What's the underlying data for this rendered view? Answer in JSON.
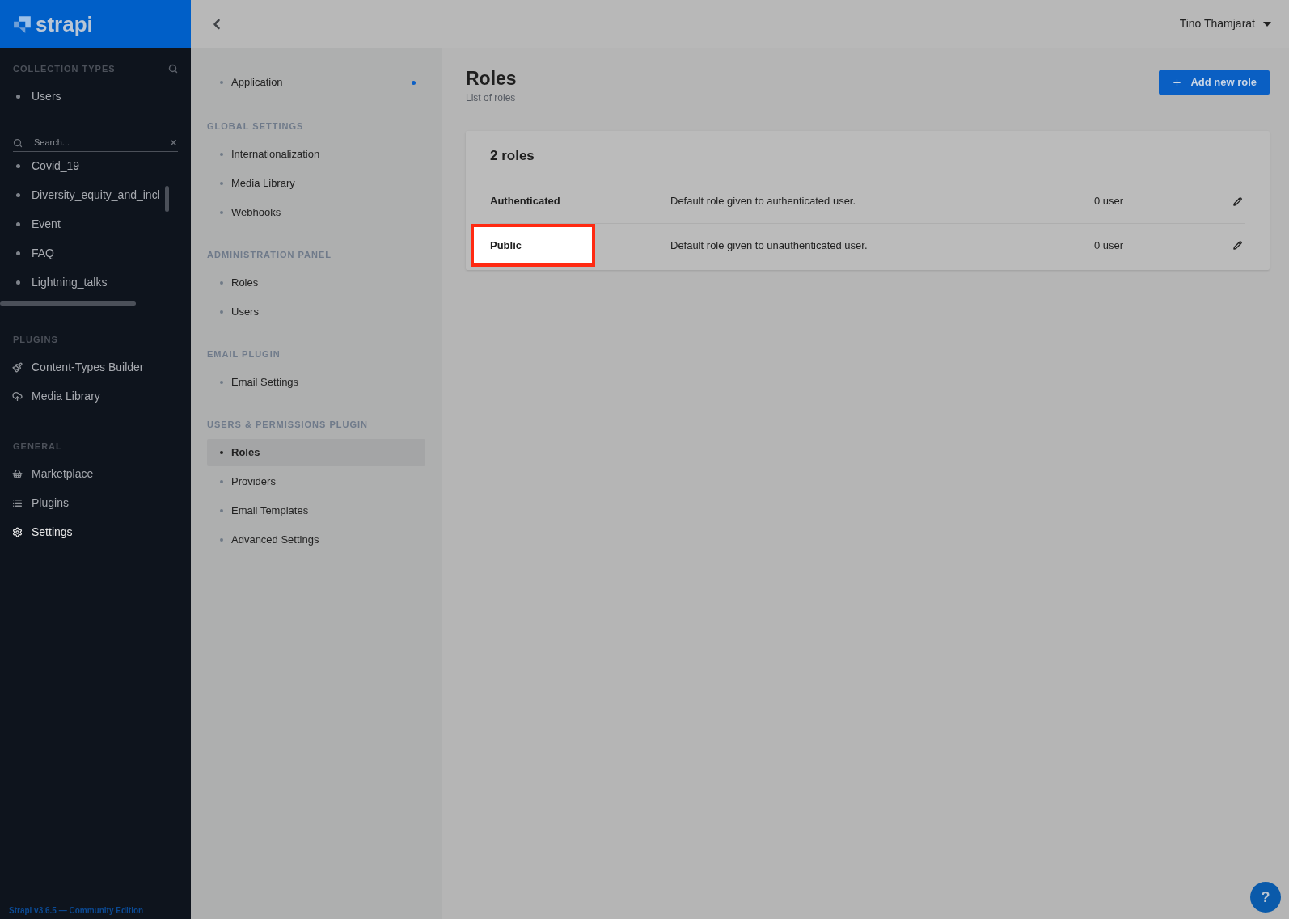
{
  "sidebar": {
    "logo": "strapi",
    "sections": [
      {
        "title": "COLLECTION TYPES",
        "has_search": true,
        "items": [
          {
            "label": "Users",
            "kind": "bullet",
            "selected": false
          }
        ]
      }
    ],
    "search": {
      "placeholder": "Search..."
    },
    "search_results": [
      {
        "label": "Covid_19"
      },
      {
        "label": "Diversity_equity_and_incl"
      },
      {
        "label": "Event"
      },
      {
        "label": "FAQ"
      },
      {
        "label": "Lightning_talks"
      }
    ],
    "groups": [
      {
        "title": "PLUGINS",
        "items": [
          {
            "label": "Content-Types Builder",
            "kind": "brush",
            "selected": false
          },
          {
            "label": "Media Library",
            "kind": "cloud",
            "selected": false
          }
        ]
      },
      {
        "title": "GENERAL",
        "items": [
          {
            "label": "Marketplace",
            "kind": "basket",
            "selected": false
          },
          {
            "label": "Plugins",
            "kind": "list",
            "selected": false
          },
          {
            "label": "Settings",
            "kind": "gear",
            "selected": true
          }
        ]
      }
    ],
    "footer": "Strapi v3.6.5 — Community Edition"
  },
  "header": {
    "user": "Tino Thamjarat"
  },
  "settings_nav": {
    "top_items": [
      {
        "label": "Application",
        "selected": false,
        "has_update": true
      }
    ],
    "sections": [
      {
        "title": "GLOBAL SETTINGS",
        "items": [
          {
            "label": "Internationalization",
            "selected": false
          },
          {
            "label": "Media Library",
            "selected": false
          },
          {
            "label": "Webhooks",
            "selected": false
          }
        ]
      },
      {
        "title": "ADMINISTRATION PANEL",
        "items": [
          {
            "label": "Roles",
            "selected": false
          },
          {
            "label": "Users",
            "selected": false
          }
        ]
      },
      {
        "title": "EMAIL PLUGIN",
        "items": [
          {
            "label": "Email Settings",
            "selected": false
          }
        ]
      },
      {
        "title": "USERS & PERMISSIONS PLUGIN",
        "items": [
          {
            "label": "Roles",
            "selected": true
          },
          {
            "label": "Providers",
            "selected": false
          },
          {
            "label": "Email Templates",
            "selected": false
          },
          {
            "label": "Advanced Settings",
            "selected": false
          }
        ]
      }
    ]
  },
  "main": {
    "title": "Roles",
    "subtitle": "List of roles",
    "add_button": "Add new role",
    "card_title": "2 roles",
    "rows": [
      {
        "name": "Authenticated",
        "description": "Default role given to authenticated user.",
        "users": "0 user",
        "highlighted": false
      },
      {
        "name": "Public",
        "description": "Default role given to unauthenticated user.",
        "users": "0 user",
        "highlighted": true
      }
    ]
  },
  "help_button": "?"
}
